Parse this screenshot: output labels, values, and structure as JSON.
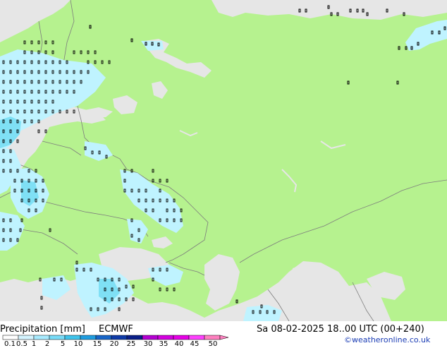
{
  "title": "Precipitation [mm]",
  "model": "ECMWF",
  "valid_time": "Sa 08-02-2025 18..00 UTC (00+240)",
  "credit": "©weatheronline.co.uk",
  "colors": {
    "land": "#b6f28f",
    "sea": "#e6e6e6",
    "border": "#7d7d7d",
    "coast": "#5a5a5a",
    "rain_light": "#bff3ff",
    "rain_medium": "#7fe0f5"
  },
  "legend": {
    "ticks": [
      "0.1",
      "0.5",
      "1",
      "2",
      "5",
      "10",
      "15",
      "20",
      "25",
      "30",
      "35",
      "40",
      "45",
      "50"
    ],
    "colors": [
      "#ffffff",
      "#d4f4ff",
      "#a8ebff",
      "#78dcf8",
      "#3fc4ec",
      "#1f9de0",
      "#1765c8",
      "#0e3aa8",
      "#0a1f88",
      "#b400d2",
      "#d400e0",
      "#e600e6",
      "#ff40ff",
      "#ff80c0"
    ]
  }
}
